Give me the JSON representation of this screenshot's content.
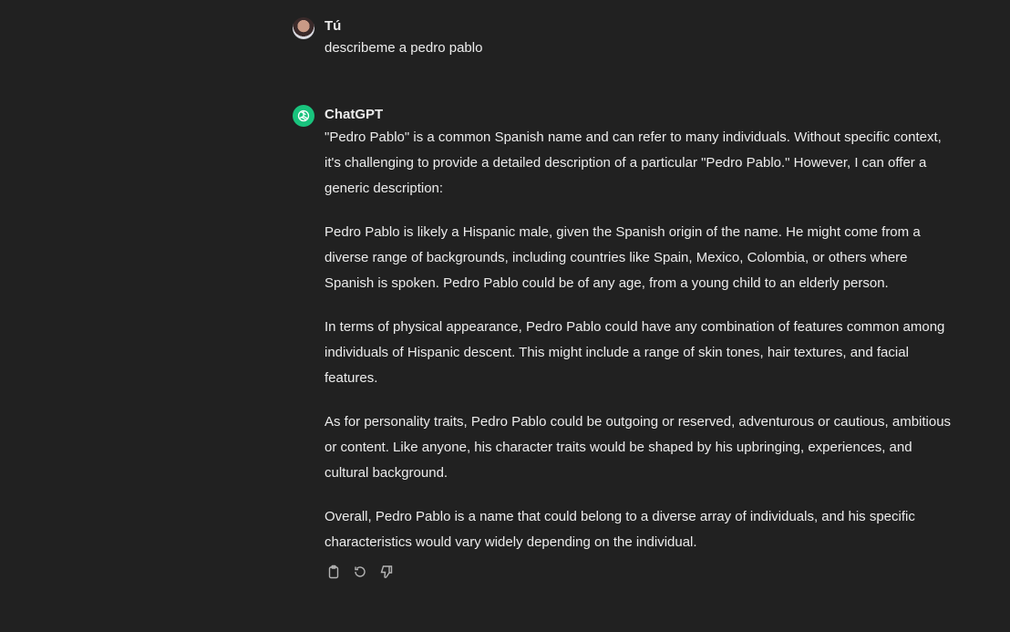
{
  "user_message": {
    "author": "Tú",
    "text": "describeme a pedro pablo"
  },
  "assistant_message": {
    "author": "ChatGPT",
    "paragraphs": [
      "\"Pedro Pablo\" is a common Spanish name and can refer to many individuals. Without specific context, it's challenging to provide a detailed description of a particular \"Pedro Pablo.\" However, I can offer a generic description:",
      "Pedro Pablo is likely a Hispanic male, given the Spanish origin of the name. He might come from a diverse range of backgrounds, including countries like Spain, Mexico, Colombia, or others where Spanish is spoken. Pedro Pablo could be of any age, from a young child to an elderly person.",
      "In terms of physical appearance, Pedro Pablo could have any combination of features common among individuals of Hispanic descent. This might include a range of skin tones, hair textures, and facial features.",
      "As for personality traits, Pedro Pablo could be outgoing or reserved, adventurous or cautious, ambitious or content. Like anyone, his character traits would be shaped by his upbringing, experiences, and cultural background.",
      "Overall, Pedro Pablo is a name that could belong to a diverse array of individuals, and his specific characteristics would vary widely depending on the individual."
    ],
    "actions": [
      "clipboard-icon",
      "regenerate-icon",
      "thumbs-down-icon"
    ]
  },
  "colors": {
    "background": "#212121",
    "text": "#ececec",
    "gpt_brand": "#19c37d",
    "icon": "#b4b4b4"
  }
}
